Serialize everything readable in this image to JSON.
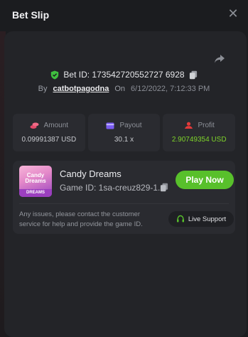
{
  "header": {
    "title": "Bet Slip",
    "close_icon": "close-icon"
  },
  "bet": {
    "id_text": "Bet ID: 173542720552727 6928",
    "by_label": "By",
    "user": "catbotpagodna",
    "on_label": "On",
    "date": "6/12/2022, 7:12:33 PM"
  },
  "stats": {
    "amount": {
      "label": "Amount",
      "value": "0.09991387 USD",
      "icon": "coins-icon"
    },
    "payout": {
      "label": "Payout",
      "value": "30.1 x",
      "icon": "wallet-icon"
    },
    "profit": {
      "label": "Profit",
      "value": "2.90749354 USD",
      "icon": "profit-icon"
    }
  },
  "game": {
    "thumb_line1": "Candy",
    "thumb_line2": "Dreams",
    "thumb_line3": "DREAMS",
    "name": "Candy Dreams",
    "id_text": "Game ID: 1sa-creuz829-1...",
    "play_label": "Play Now"
  },
  "footer": {
    "issue_text": "Any issues, please contact the customer service for help and provide the game ID.",
    "support_label": "Live Support"
  },
  "colors": {
    "accent_green": "#58c02b",
    "profit_green": "#7ed32a",
    "shield_green": "#3fbf3f",
    "amount_icon": "#e24a6a",
    "payout_icon": "#7a5cf0",
    "profit_icon": "#e23a3a"
  }
}
